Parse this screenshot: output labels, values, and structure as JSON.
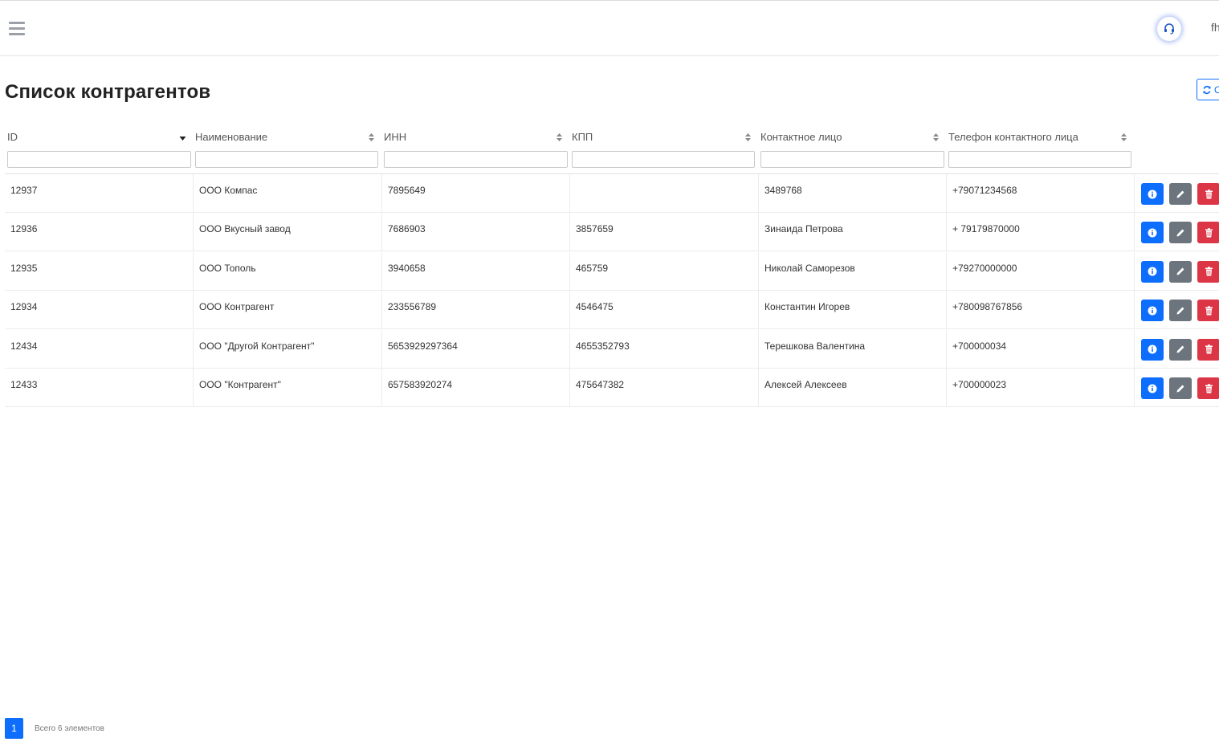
{
  "header": {
    "user_name": "fh"
  },
  "page": {
    "title": "Список контрагентов",
    "refresh_label": "О"
  },
  "table": {
    "columns": [
      "ID",
      "Наименование",
      "ИНН",
      "КПП",
      "Контактное лицо",
      "Телефон контактного лица"
    ],
    "sorted_column": "ID",
    "sort_direction": "desc",
    "rows": [
      [
        "12937",
        "ООО Компас",
        "7895649",
        "",
        "3489768",
        "+79071234568"
      ],
      [
        "12936",
        "ООО Вкусный завод",
        "7686903",
        "3857659",
        "Зинаида Петрова",
        "+ 79179870000"
      ],
      [
        "12935",
        "ООО Тополь",
        "3940658",
        "465759",
        "Николай Саморезов",
        "+79270000000"
      ],
      [
        "12934",
        "ООО Контрагент",
        "233556789",
        "4546475",
        "Константин Игорев",
        "+780098767856"
      ],
      [
        "12434",
        "ООО \"Другой Контрагент\"",
        "5653929297364",
        "4655352793",
        "Терешкова Валентина",
        "+700000034"
      ],
      [
        "12433",
        "ООО \"Контрагент\"",
        "657583920274",
        "475647382",
        "Алексей Алексеев",
        "+700000023"
      ]
    ]
  },
  "pagination": {
    "current_page": "1",
    "total_text": "Всего 6 элементов"
  },
  "icons": {
    "menu": "hamburger-icon",
    "support": "headset-icon",
    "refresh": "refresh-icon",
    "info": "info-icon",
    "edit": "pencil-icon",
    "delete": "trash-icon",
    "sort": "sort-arrows-icon"
  },
  "colors": {
    "primary": "#0d6efd",
    "secondary": "#6c757d",
    "danger": "#dc3545"
  }
}
